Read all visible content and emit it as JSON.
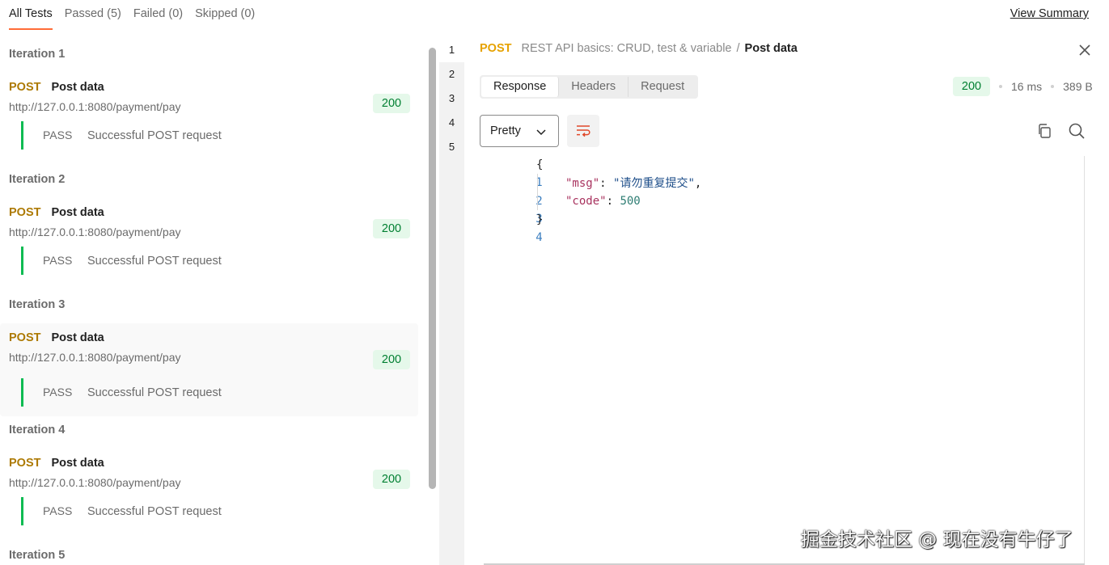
{
  "tabs": [
    {
      "label": "All Tests"
    },
    {
      "label": "Passed (5)"
    },
    {
      "label": "Failed (0)"
    },
    {
      "label": "Skipped (0)"
    }
  ],
  "view_summary": "View Summary",
  "iterations": [
    {
      "title": "Iteration 1",
      "method": "POST",
      "name": "Post data",
      "url": "http://127.0.0.1:8080/payment/pay",
      "status": "200",
      "test_result": "PASS",
      "test_name": "Successful POST request"
    },
    {
      "title": "Iteration 2",
      "method": "POST",
      "name": "Post data",
      "url": "http://127.0.0.1:8080/payment/pay",
      "status": "200",
      "test_result": "PASS",
      "test_name": "Successful POST request"
    },
    {
      "title": "Iteration 3",
      "method": "POST",
      "name": "Post data",
      "url": "http://127.0.0.1:8080/payment/pay",
      "status": "200",
      "test_result": "PASS",
      "test_name": "Successful POST request"
    },
    {
      "title": "Iteration 4",
      "method": "POST",
      "name": "Post data",
      "url": "http://127.0.0.1:8080/payment/pay",
      "status": "200",
      "test_result": "PASS",
      "test_name": "Successful POST request"
    },
    {
      "title": "Iteration 5"
    }
  ],
  "request_numbers": [
    "1",
    "2",
    "3",
    "4",
    "5"
  ],
  "detail": {
    "method": "POST",
    "collection": "REST API basics: CRUD, test & variable",
    "separator": "/",
    "request_name": "Post data",
    "response_tabs": [
      "Response",
      "Headers",
      "Request"
    ],
    "status": "200",
    "time": "16 ms",
    "size": "389 B",
    "format": "Pretty"
  },
  "code": {
    "line_numbers": [
      "1",
      "2",
      "3",
      "4"
    ],
    "open_brace": "{",
    "close_brace": "}",
    "msg_key": "\"msg\"",
    "msg_value": "\"请勿重复提交\"",
    "code_key": "\"code\"",
    "code_value": "500"
  },
  "watermark": "掘金技术社区 @ 现在没有牛仔了"
}
